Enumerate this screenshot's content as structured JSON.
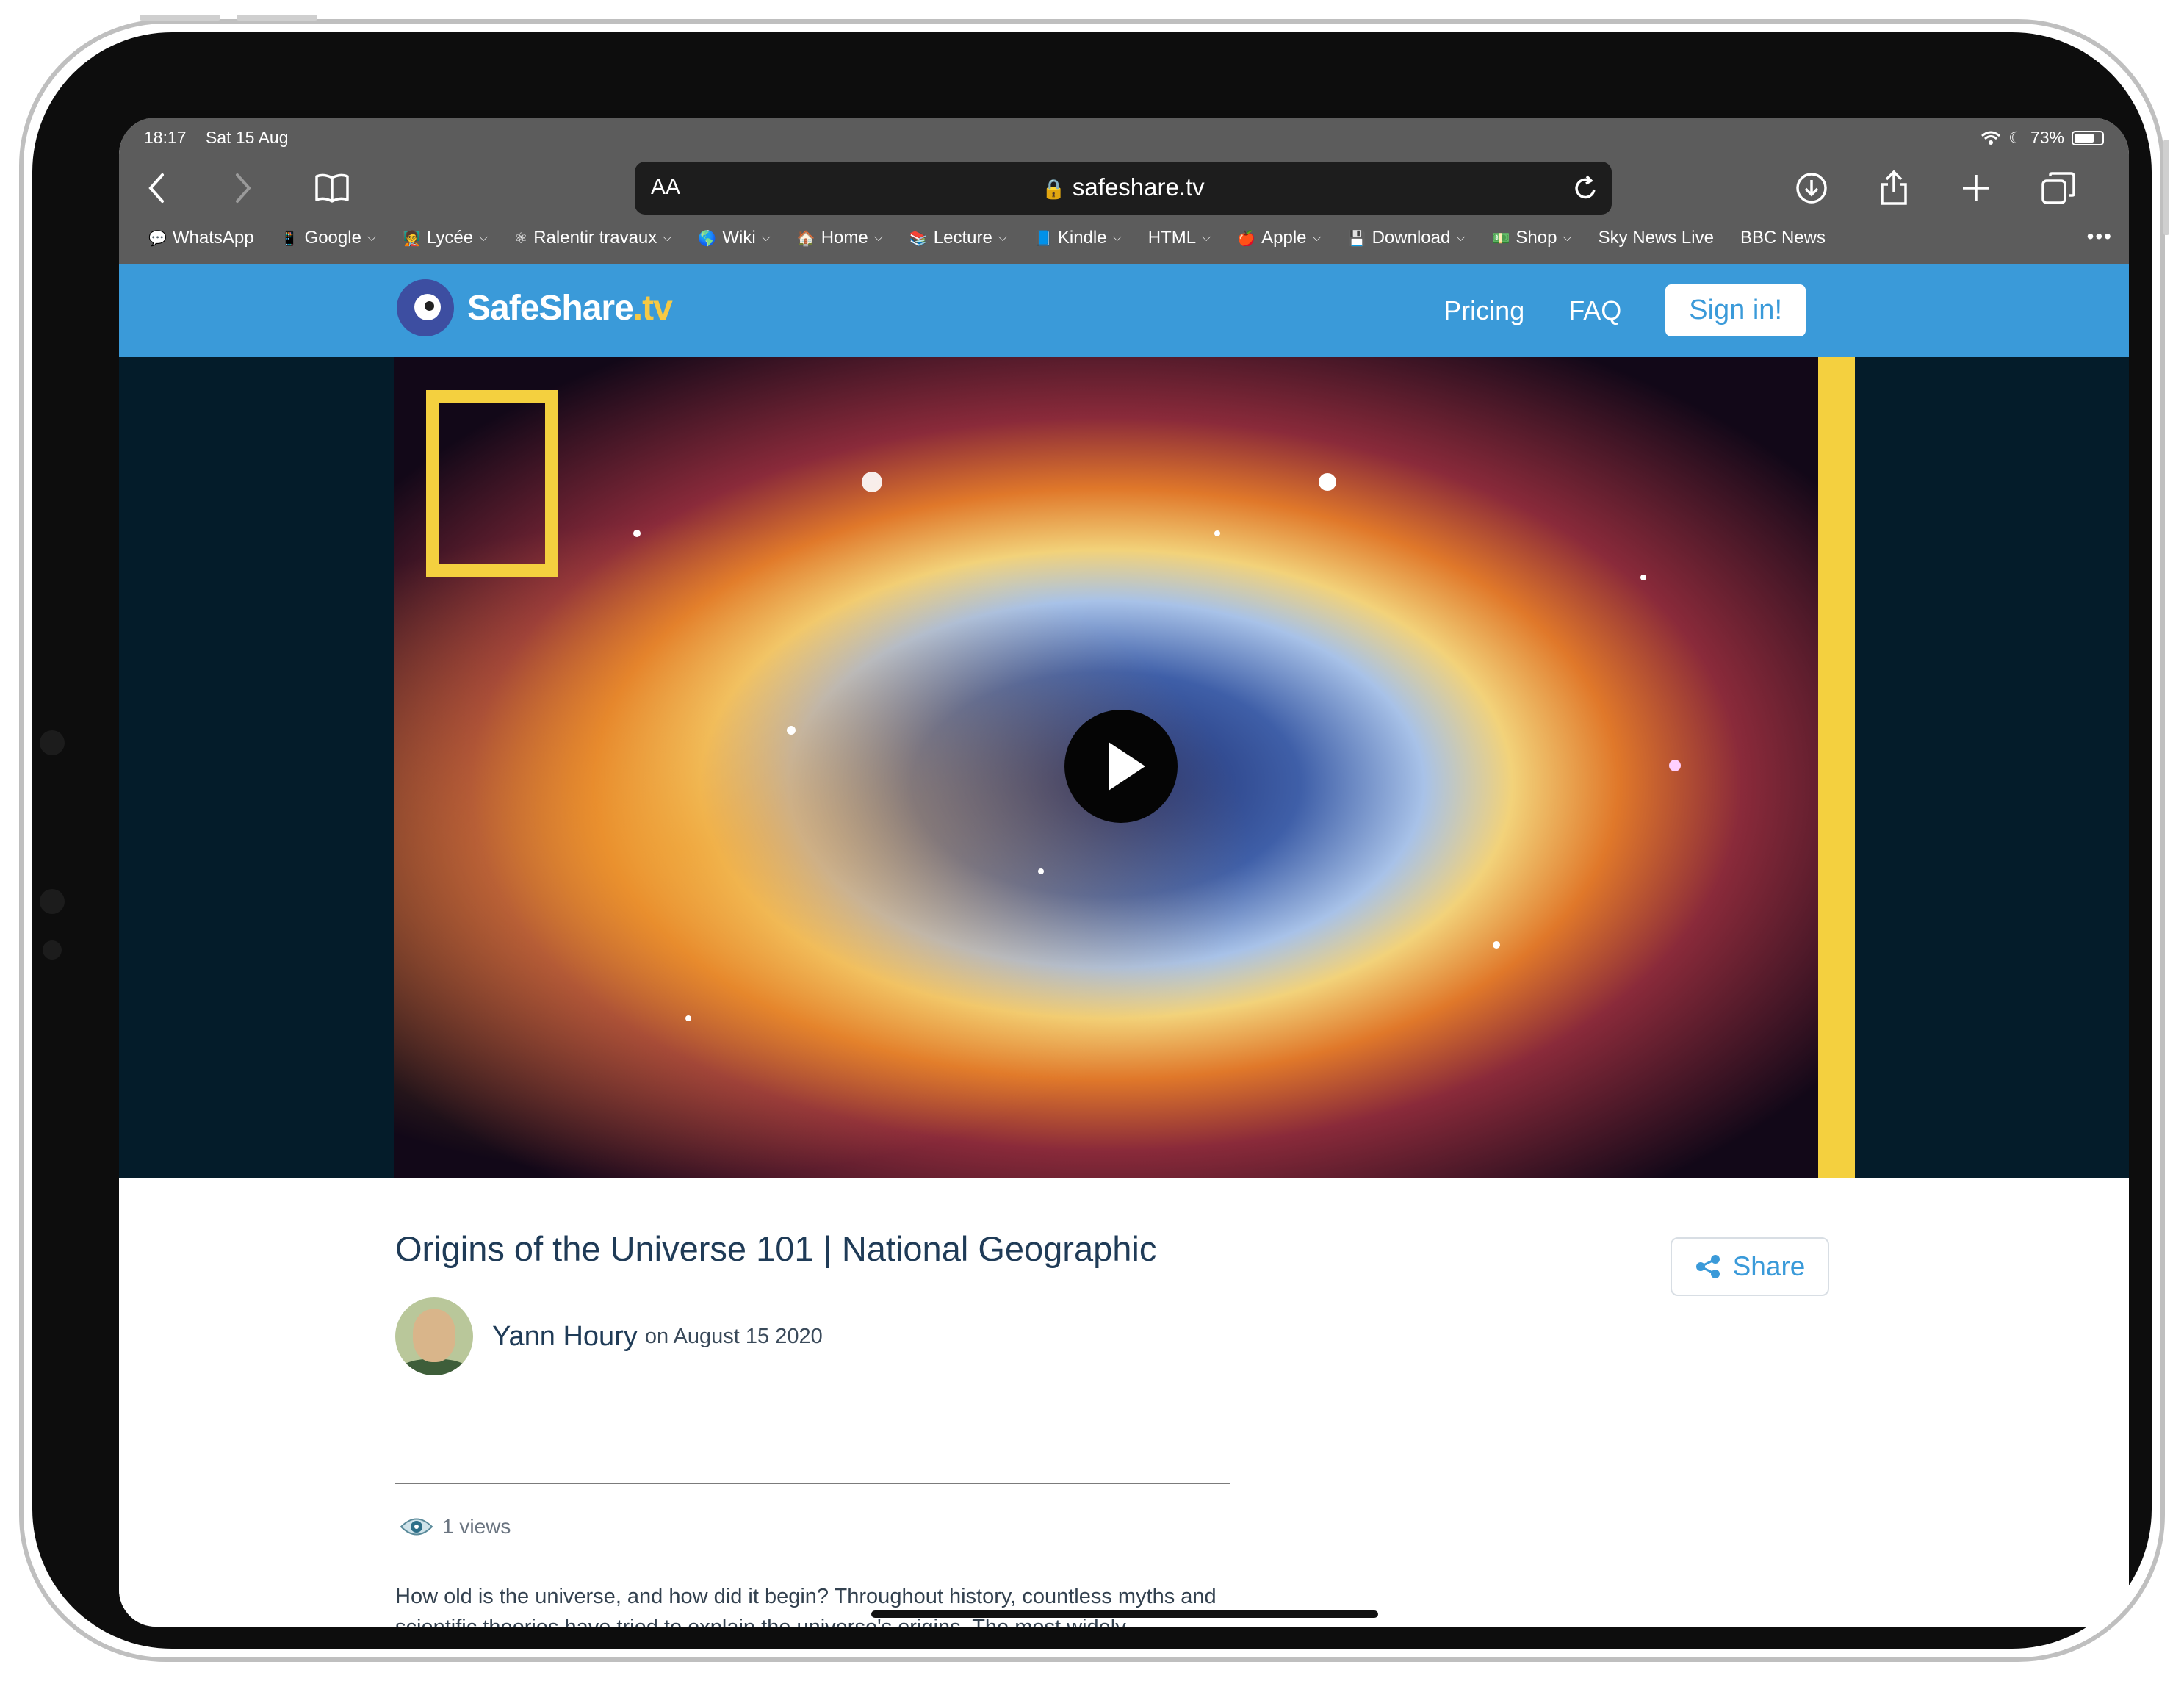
{
  "status": {
    "time": "18:17",
    "date": "Sat 15 Aug",
    "battery": "73%",
    "battery_level": 0.73
  },
  "toolbar": {
    "aa_label": "AA",
    "url": "safeshare.tv",
    "icons": [
      "back-icon",
      "forward-icon",
      "bookmarks-icon",
      "reload-icon",
      "download-icon",
      "share-icon",
      "new-tab-icon",
      "tabs-icon"
    ]
  },
  "bookmarks": [
    {
      "label": "WhatsApp",
      "icon": "💬",
      "menu": false
    },
    {
      "label": "Google",
      "icon": "📱",
      "menu": true
    },
    {
      "label": "Lycée",
      "icon": "🧑‍🏫",
      "menu": true
    },
    {
      "label": "Ralentir travaux",
      "icon": "⚛",
      "menu": true
    },
    {
      "label": "Wiki",
      "icon": "🌎",
      "menu": true
    },
    {
      "label": "Home",
      "icon": "🏠",
      "menu": true
    },
    {
      "label": "Lecture",
      "icon": "📚",
      "menu": true
    },
    {
      "label": "Kindle",
      "icon": "📘",
      "menu": true
    },
    {
      "label": "HTML",
      "icon": "",
      "menu": true
    },
    {
      "label": "Apple",
      "icon": "🍎",
      "menu": true
    },
    {
      "label": "Download",
      "icon": "💾",
      "menu": true
    },
    {
      "label": "Shop",
      "icon": "💵",
      "menu": true
    },
    {
      "label": "Sky News Live",
      "icon": "",
      "menu": false
    },
    {
      "label": "BBC News",
      "icon": "",
      "menu": false
    }
  ],
  "bookmarks_more": "•••",
  "site": {
    "logo_main": "SafeShare",
    "logo_suffix": ".tv",
    "nav": {
      "pricing": "Pricing",
      "faq": "FAQ",
      "signin": "Sign in!"
    }
  },
  "video": {
    "title": "Origins of the Universe 101 | National Geographic",
    "share_label": "Share",
    "author": "Yann Houry",
    "date_prefix": "on August 15 2020",
    "views": "1 views",
    "description": "How old is the universe, and how did it begin? Throughout history, countless myths and scientific theories have tried to explain the universe's origins. The most widely accepted explanation is the big bang theory. Learn about the explosion that started it all and how the universe grew from the size of an atom"
  },
  "colors": {
    "brand_blue": "#3a9ad9",
    "brand_yellow": "#f4d03f",
    "video_bg": "#041c2a",
    "chrome": "#5c5c5c"
  }
}
